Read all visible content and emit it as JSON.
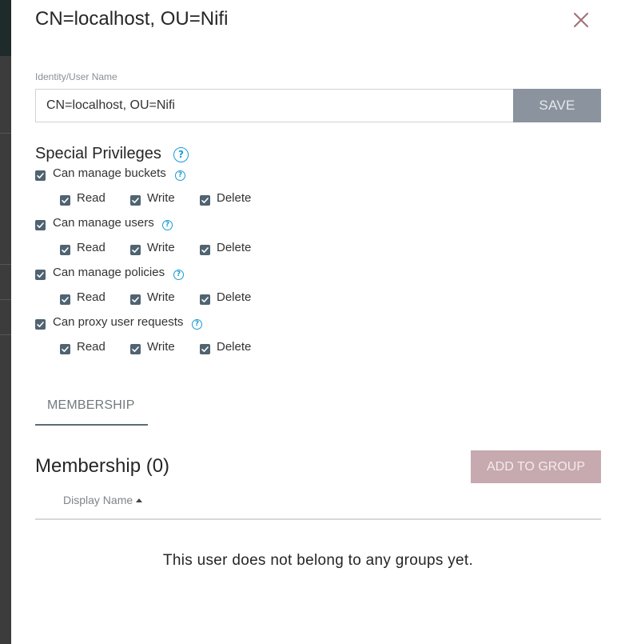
{
  "dialog": {
    "title": "CN=localhost, OU=Nifi",
    "close_icon": "close-icon"
  },
  "identity": {
    "label": "Identity/User Name",
    "value": "CN=localhost, OU=Nifi",
    "save_label": "SAVE"
  },
  "special_privileges": {
    "heading": "Special Privileges",
    "help_glyph": "?",
    "privileges": [
      {
        "label": "Can manage buckets",
        "checked": true,
        "perms": [
          {
            "label": "Read",
            "checked": true
          },
          {
            "label": "Write",
            "checked": true
          },
          {
            "label": "Delete",
            "checked": true
          }
        ]
      },
      {
        "label": "Can manage users",
        "checked": true,
        "perms": [
          {
            "label": "Read",
            "checked": true
          },
          {
            "label": "Write",
            "checked": true
          },
          {
            "label": "Delete",
            "checked": true
          }
        ]
      },
      {
        "label": "Can manage policies",
        "checked": true,
        "perms": [
          {
            "label": "Read",
            "checked": true
          },
          {
            "label": "Write",
            "checked": true
          },
          {
            "label": "Delete",
            "checked": true
          }
        ]
      },
      {
        "label": "Can proxy user requests",
        "checked": true,
        "perms": [
          {
            "label": "Read",
            "checked": true
          },
          {
            "label": "Write",
            "checked": true
          },
          {
            "label": "Delete",
            "checked": true
          }
        ]
      }
    ]
  },
  "tabs": [
    {
      "label": "MEMBERSHIP",
      "active": true
    }
  ],
  "membership": {
    "heading": "Membership (0)",
    "add_label": "ADD TO GROUP",
    "column_header": "Display Name",
    "sort_icon": "sort-ascending-icon",
    "empty_message": "This user does not belong to any groups yet."
  },
  "colors": {
    "checkbox": "#4f6371",
    "help": "#1b9ad4",
    "save_button": "#8a939e",
    "add_button": "#c7a9b0",
    "close_icon": "#a0757e"
  }
}
